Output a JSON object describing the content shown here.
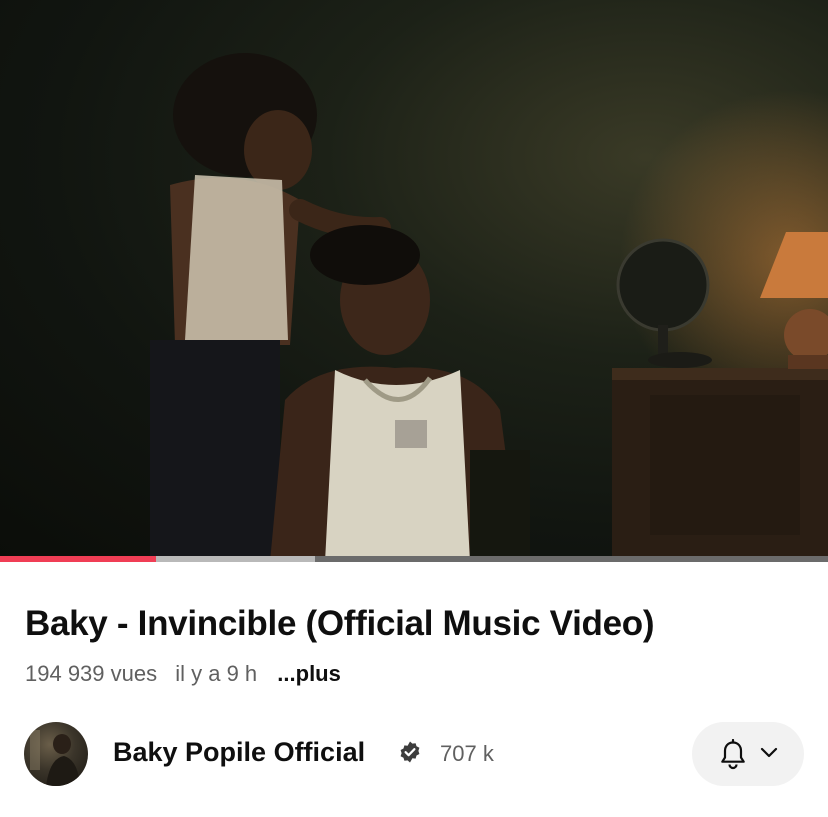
{
  "video": {
    "title": "Baky - Invincible (Official Music Video)",
    "views": "194 939 vues",
    "age": "il y a 9 h",
    "more_label": "...plus",
    "progress": {
      "played_fraction": 0.188,
      "buffered_fraction": 0.38
    }
  },
  "channel": {
    "name": "Baky Popile Official",
    "verified": true,
    "subscribers": "707 k"
  },
  "actions": {
    "notification_icon": "bell-icon",
    "dropdown_icon": "chevron-down-icon"
  },
  "colors": {
    "progress_played": "#f03e55",
    "title_text": "#0f0f0f",
    "meta_text": "#606060",
    "pill_background": "#f2f2f2"
  }
}
